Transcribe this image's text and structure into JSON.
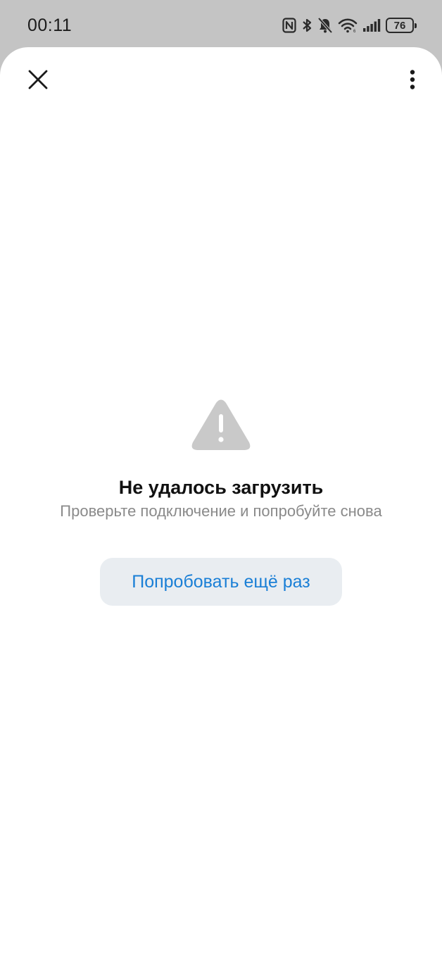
{
  "status_bar": {
    "time": "00:11",
    "battery_level": "76",
    "icons": [
      "nfc-icon",
      "bluetooth-icon",
      "mute-icon",
      "wifi-icon",
      "signal-icon",
      "battery-icon"
    ]
  },
  "header": {
    "close_icon": "close-icon",
    "menu_icon": "more-vertical-icon"
  },
  "error": {
    "icon": "warning-icon",
    "title": "Не удалось загрузить",
    "subtitle": "Проверьте подключение и попробуйте снова",
    "retry_label": "Попробовать ещё раз"
  },
  "colors": {
    "background_dim": "#c4c4c4",
    "sheet": "#ffffff",
    "accent": "#1a7fd6",
    "button_bg": "#e9edf1",
    "warning_icon": "#c9c9c9"
  }
}
